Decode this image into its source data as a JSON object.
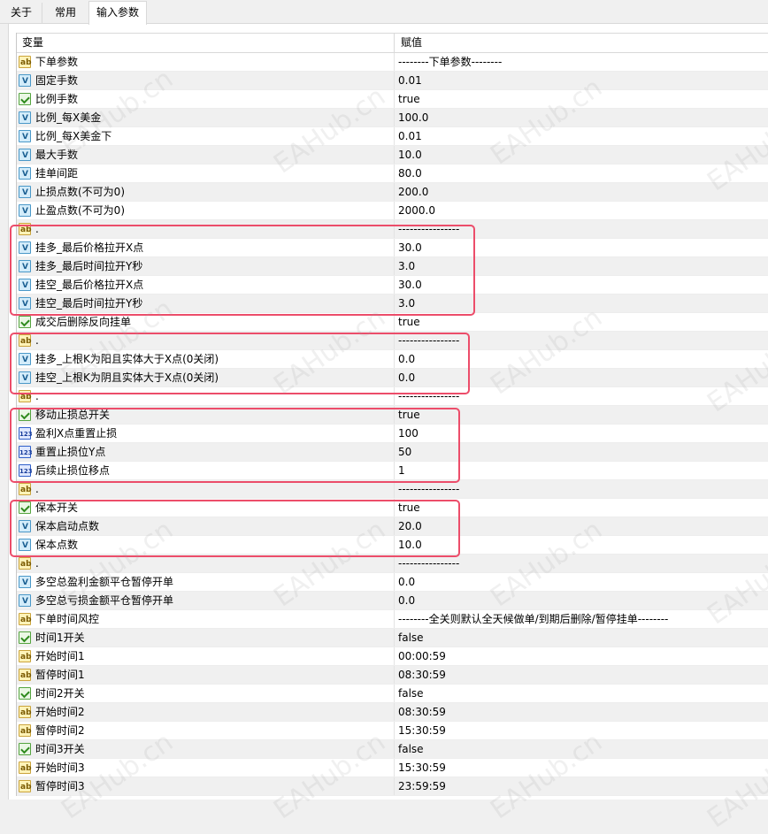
{
  "tabs": [
    "关于",
    "常用",
    "输入参数"
  ],
  "header": {
    "col1": "变量",
    "col2": "赋值"
  },
  "rows": [
    {
      "icon": "ab",
      "name": "下单参数",
      "value": "--------下单参数--------"
    },
    {
      "icon": "va",
      "name": "固定手数",
      "value": "0.01"
    },
    {
      "icon": "bool",
      "name": "比例手数",
      "value": "true"
    },
    {
      "icon": "va",
      "name": "比例_每X美金",
      "value": "100.0"
    },
    {
      "icon": "va",
      "name": "比例_每X美金下",
      "value": "0.01"
    },
    {
      "icon": "va",
      "name": "最大手数",
      "value": "10.0"
    },
    {
      "icon": "va",
      "name": "挂单间距",
      "value": "80.0"
    },
    {
      "icon": "va",
      "name": "止损点数(不可为0)",
      "value": "200.0"
    },
    {
      "icon": "va",
      "name": "止盈点数(不可为0)",
      "value": "2000.0"
    },
    {
      "icon": "ab",
      "name": ".",
      "value": "----------------"
    },
    {
      "icon": "va",
      "name": "挂多_最后价格拉开X点",
      "value": "30.0"
    },
    {
      "icon": "va",
      "name": "挂多_最后时间拉开Y秒",
      "value": "3.0"
    },
    {
      "icon": "va",
      "name": "挂空_最后价格拉开X点",
      "value": "30.0"
    },
    {
      "icon": "va",
      "name": "挂空_最后时间拉开Y秒",
      "value": "3.0"
    },
    {
      "icon": "bool",
      "name": "成交后删除反向挂单",
      "value": "true"
    },
    {
      "icon": "ab",
      "name": ".",
      "value": "----------------"
    },
    {
      "icon": "va",
      "name": "挂多_上根K为阳且实体大于X点(0关闭)",
      "value": "0.0"
    },
    {
      "icon": "va",
      "name": "挂空_上根K为阴且实体大于X点(0关闭)",
      "value": "0.0"
    },
    {
      "icon": "ab",
      "name": ".",
      "value": "----------------"
    },
    {
      "icon": "bool",
      "name": "移动止损总开关",
      "value": "true"
    },
    {
      "icon": "int",
      "name": "盈利X点重置止损",
      "value": "100"
    },
    {
      "icon": "int",
      "name": "重置止损位Y点",
      "value": "50"
    },
    {
      "icon": "int",
      "name": "后续止损位移点",
      "value": "1"
    },
    {
      "icon": "ab",
      "name": ".",
      "value": "----------------"
    },
    {
      "icon": "bool",
      "name": "保本开关",
      "value": "true"
    },
    {
      "icon": "va",
      "name": "保本启动点数",
      "value": "20.0"
    },
    {
      "icon": "va",
      "name": "保本点数",
      "value": "10.0"
    },
    {
      "icon": "ab",
      "name": ".",
      "value": "----------------"
    },
    {
      "icon": "va",
      "name": "多空总盈利金额平仓暂停开单",
      "value": "0.0"
    },
    {
      "icon": "va",
      "name": "多空总亏损金额平仓暂停开单",
      "value": "0.0"
    },
    {
      "icon": "ab",
      "name": "下单时间风控",
      "value": "--------全关则默认全天候做单/到期后删除/暂停挂单--------"
    },
    {
      "icon": "bool",
      "name": "时间1开关",
      "value": "false"
    },
    {
      "icon": "ab",
      "name": "开始时间1",
      "value": "00:00:59"
    },
    {
      "icon": "ab",
      "name": "暂停时间1",
      "value": "08:30:59"
    },
    {
      "icon": "bool",
      "name": "时间2开关",
      "value": "false"
    },
    {
      "icon": "ab",
      "name": "开始时间2",
      "value": "08:30:59"
    },
    {
      "icon": "ab",
      "name": "暂停时间2",
      "value": "15:30:59"
    },
    {
      "icon": "bool",
      "name": "时间3开关",
      "value": "false"
    },
    {
      "icon": "ab",
      "name": "开始时间3",
      "value": "15:30:59"
    },
    {
      "icon": "ab",
      "name": "暂停时间3",
      "value": "23:59:59"
    }
  ],
  "watermark": "EAHub.cn",
  "colors": {
    "highlight": "#ec4d6a",
    "alt_row": "#f0f0f0"
  }
}
